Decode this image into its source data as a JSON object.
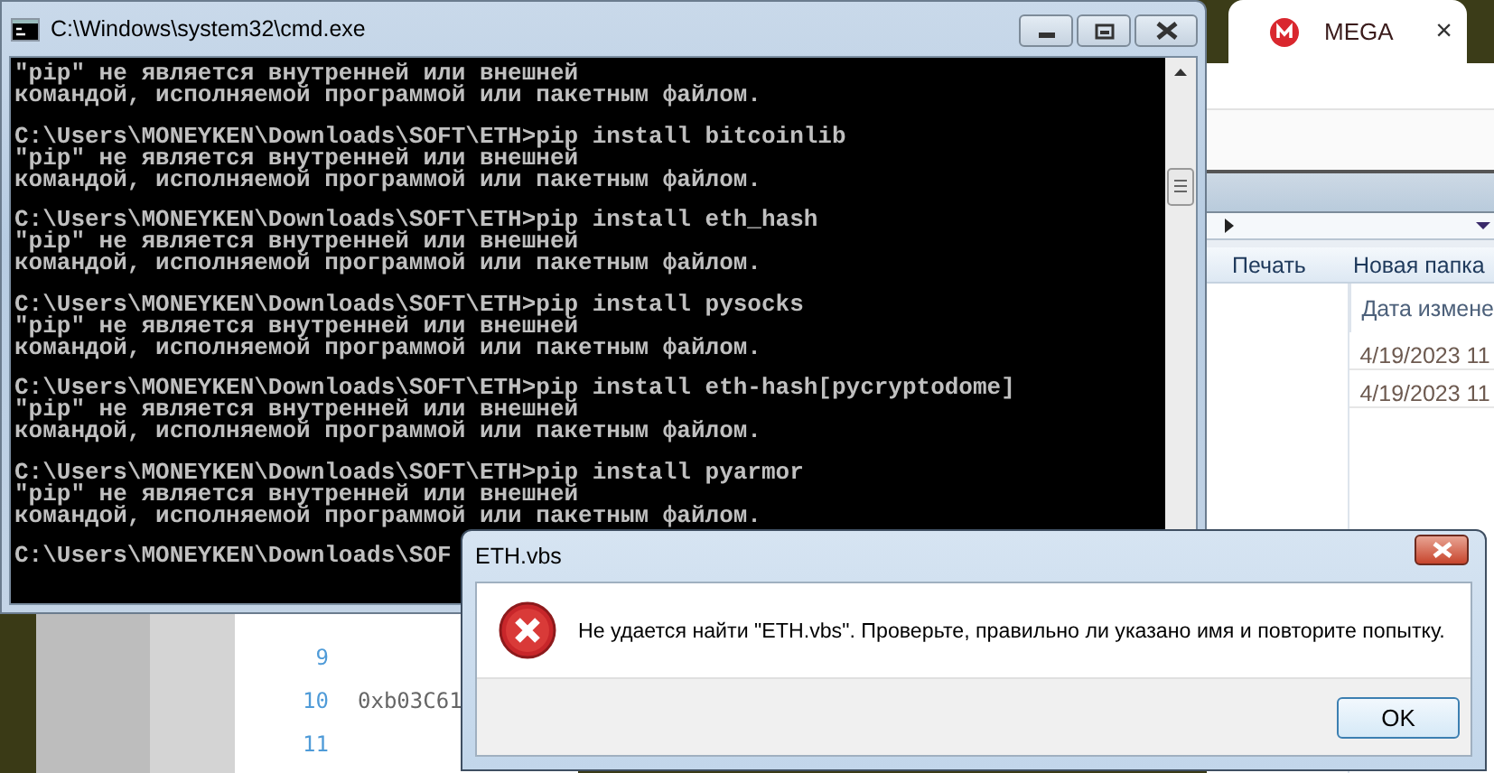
{
  "cmd_window": {
    "title": "C:\\Windows\\system32\\cmd.exe",
    "console": [
      {
        "output": [
          "\"pip\" не является внутренней или внешней",
          "командой, исполняемой программой или пакетным файлом."
        ]
      },
      {
        "command": "C:\\Users\\MONEYKEN\\Downloads\\SOFT\\ETH>pip install bitcoinlib",
        "output": [
          "\"pip\" не является внутренней или внешней",
          "командой, исполняемой программой или пакетным файлом."
        ]
      },
      {
        "command": "C:\\Users\\MONEYKEN\\Downloads\\SOFT\\ETH>pip install eth_hash",
        "output": [
          "\"pip\" не является внутренней или внешней",
          "командой, исполняемой программой или пакетным файлом."
        ]
      },
      {
        "command": "C:\\Users\\MONEYKEN\\Downloads\\SOFT\\ETH>pip install pysocks",
        "output": [
          "\"pip\" не является внутренней или внешней",
          "командой, исполняемой программой или пакетным файлом."
        ]
      },
      {
        "command": "C:\\Users\\MONEYKEN\\Downloads\\SOFT\\ETH>pip install eth-hash[pycryptodome]",
        "output": [
          "\"pip\" не является внутренней или внешней",
          "командой, исполняемой программой или пакетным файлом."
        ]
      },
      {
        "command": "C:\\Users\\MONEYKEN\\Downloads\\SOFT\\ETH>pip install pyarmor",
        "output": [
          "\"pip\" не является внутренней или внешней",
          "командой, исполняемой программой или пакетным файлом."
        ]
      },
      {
        "command": "C:\\Users\\MONEYKEN\\Downloads\\SOF"
      }
    ]
  },
  "editor": {
    "lines": [
      {
        "number": "9"
      },
      {
        "number": "10",
        "text": "0xb03C61"
      },
      {
        "number": "11"
      }
    ]
  },
  "browser": {
    "tab": {
      "title": "MEGA",
      "close": "×"
    },
    "explorer": {
      "toolbar": [
        "Печать",
        "Новая папка"
      ],
      "columns": [
        "Дата измене"
      ],
      "rows": [
        "4/19/2023 11",
        "4/19/2023 11"
      ]
    }
  },
  "dialog": {
    "title": "ETH.vbs",
    "message": "Не удается найти \"ETH.vbs\". Проверьте, правильно ли указано имя и повторите попытку.",
    "buttons": [
      "OK"
    ]
  }
}
